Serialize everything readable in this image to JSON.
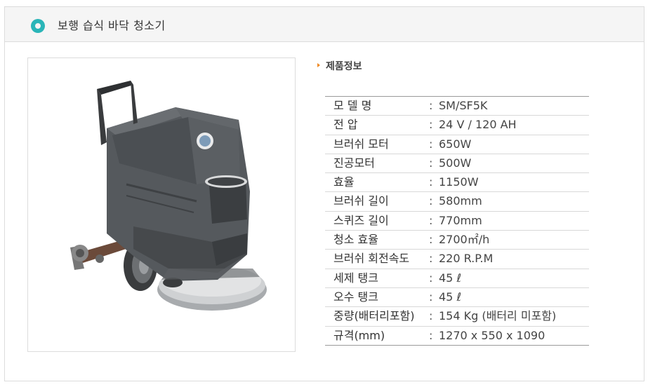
{
  "header": {
    "title": "보행 습식 바닥 청소기"
  },
  "product": {
    "image_alt": "floor-scrubber-photo",
    "info_heading": "제품정보",
    "separator": ":"
  },
  "specs": [
    {
      "label": "모 델 명",
      "value": "SM/SF5K"
    },
    {
      "label": "전 압",
      "value": "24 V / 120 AH"
    },
    {
      "label": "브러쉬 모터",
      "value": "650W"
    },
    {
      "label": "진공모터",
      "value": "500W"
    },
    {
      "label": "효율",
      "value": "1150W"
    },
    {
      "label": "브러쉬 길이",
      "value": "580mm"
    },
    {
      "label": "스퀴즈 길이",
      "value": "770mm"
    },
    {
      "label": "청소 효율",
      "value": "2700㎡/h"
    },
    {
      "label": "브러쉬 회전속도",
      "value": "220 R.P.M"
    },
    {
      "label": "세제 탱크",
      "value": "45 ℓ"
    },
    {
      "label": "오수 탱크",
      "value": "45 ℓ"
    },
    {
      "label": "중량(배터리포함)",
      "value": "154 Kg (배터리 미포함)"
    },
    {
      "label": "규격(mm)",
      "value": "1270 x 550 x 1090"
    }
  ],
  "colors": {
    "accent_ring": "#2ab5b8",
    "heading_arrow": "#f08a24",
    "machine_body": "#55595d"
  }
}
